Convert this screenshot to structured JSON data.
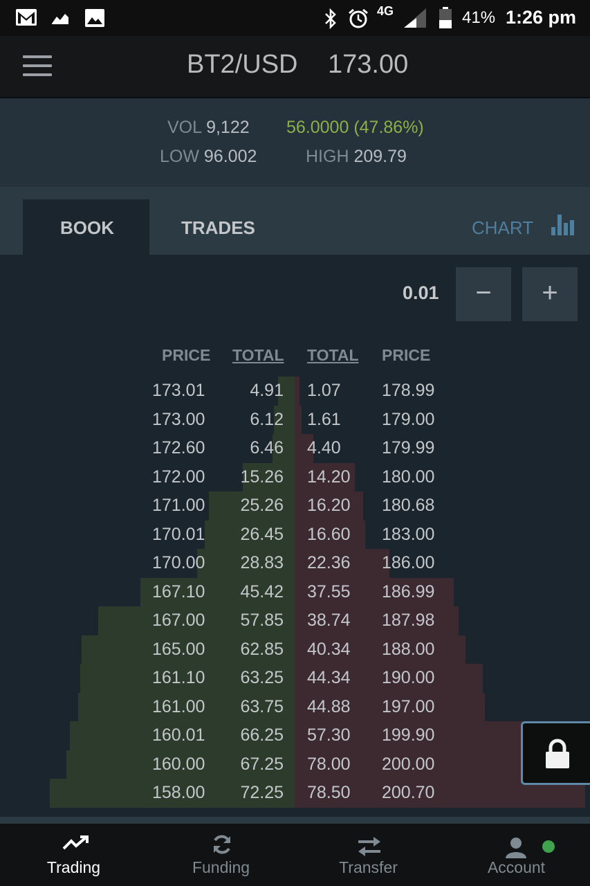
{
  "status_bar": {
    "battery": "41%",
    "time": "1:26 pm",
    "network": "4G"
  },
  "header": {
    "pair": "BT2/USD",
    "last_price": "173.00"
  },
  "stats": {
    "vol_label": "VOL",
    "vol_value": "9,122",
    "change": "56.0000 (47.86%)",
    "low_label": "LOW",
    "low_value": "96.002",
    "high_label": "HIGH",
    "high_value": "209.79"
  },
  "tabs": {
    "book": "BOOK",
    "trades": "TRADES",
    "chart": "CHART"
  },
  "stepper": {
    "value": "0.01",
    "minus": "−",
    "plus": "+"
  },
  "book": {
    "headers": [
      "PRICE",
      "TOTAL",
      "TOTAL",
      "PRICE"
    ],
    "bids": [
      {
        "price": "173.01",
        "total": "4.91"
      },
      {
        "price": "173.00",
        "total": "6.12"
      },
      {
        "price": "172.60",
        "total": "6.46"
      },
      {
        "price": "172.00",
        "total": "15.26"
      },
      {
        "price": "171.00",
        "total": "25.26"
      },
      {
        "price": "170.01",
        "total": "26.45"
      },
      {
        "price": "170.00",
        "total": "28.83"
      },
      {
        "price": "167.10",
        "total": "45.42"
      },
      {
        "price": "167.00",
        "total": "57.85"
      },
      {
        "price": "165.00",
        "total": "62.85"
      },
      {
        "price": "161.10",
        "total": "63.25"
      },
      {
        "price": "161.00",
        "total": "63.75"
      },
      {
        "price": "160.01",
        "total": "66.25"
      },
      {
        "price": "160.00",
        "total": "67.25"
      },
      {
        "price": "158.00",
        "total": "72.25"
      }
    ],
    "asks": [
      {
        "price": "178.99",
        "total": "1.07"
      },
      {
        "price": "179.00",
        "total": "1.61"
      },
      {
        "price": "179.99",
        "total": "4.40"
      },
      {
        "price": "180.00",
        "total": "14.20"
      },
      {
        "price": "180.68",
        "total": "16.20"
      },
      {
        "price": "183.00",
        "total": "16.60"
      },
      {
        "price": "186.00",
        "total": "22.36"
      },
      {
        "price": "186.99",
        "total": "37.55"
      },
      {
        "price": "187.98",
        "total": "38.74"
      },
      {
        "price": "188.00",
        "total": "40.34"
      },
      {
        "price": "190.00",
        "total": "44.34"
      },
      {
        "price": "197.00",
        "total": "44.88"
      },
      {
        "price": "199.90",
        "total": "57.30"
      },
      {
        "price": "200.00",
        "total": "78.00"
      },
      {
        "price": "200.70",
        "total": "78.50"
      }
    ]
  },
  "colors": {
    "bid_depth": "#2c3b2c",
    "ask_depth": "#3d2a31",
    "change_positive": "#8bb04a",
    "accent": "#4f7f9f"
  },
  "nav": [
    {
      "label": "Trading",
      "icon": "trending-up-icon",
      "active": true
    },
    {
      "label": "Funding",
      "icon": "refresh-icon",
      "active": false
    },
    {
      "label": "Transfer",
      "icon": "transfer-icon",
      "active": false
    },
    {
      "label": "Account",
      "icon": "user-icon",
      "active": false
    }
  ]
}
